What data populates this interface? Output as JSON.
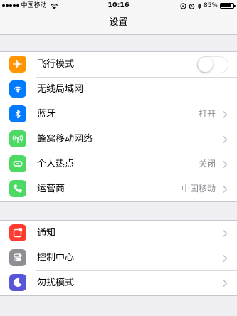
{
  "status_bar": {
    "carrier": "中国移动",
    "time": "10:16",
    "battery_percent": "85%",
    "battery_level": 0.85
  },
  "nav": {
    "title": "设置"
  },
  "group1": [
    {
      "label": "飞行模式",
      "icon": "airplane-icon",
      "color": "#ff9500",
      "control": "toggle",
      "toggle_on": false
    },
    {
      "label": "无线局域网",
      "icon": "wifi-icon",
      "color": "#007aff",
      "value": ""
    },
    {
      "label": "蓝牙",
      "icon": "bluetooth-icon",
      "color": "#007aff",
      "value": "打开"
    },
    {
      "label": "蜂窝移动网络",
      "icon": "cellular-icon",
      "color": "#4cd964",
      "value": ""
    },
    {
      "label": "个人热点",
      "icon": "hotspot-icon",
      "color": "#4cd964",
      "value": "关闭"
    },
    {
      "label": "运营商",
      "icon": "phone-icon",
      "color": "#4cd964",
      "value": "中国移动"
    }
  ],
  "group2": [
    {
      "label": "通知",
      "icon": "notification-icon",
      "color": "#ff3b30",
      "value": ""
    },
    {
      "label": "控制中心",
      "icon": "control-center-icon",
      "color": "#8e8e93",
      "value": ""
    },
    {
      "label": "勿扰模式",
      "icon": "moon-icon",
      "color": "#5856d6",
      "value": ""
    }
  ]
}
